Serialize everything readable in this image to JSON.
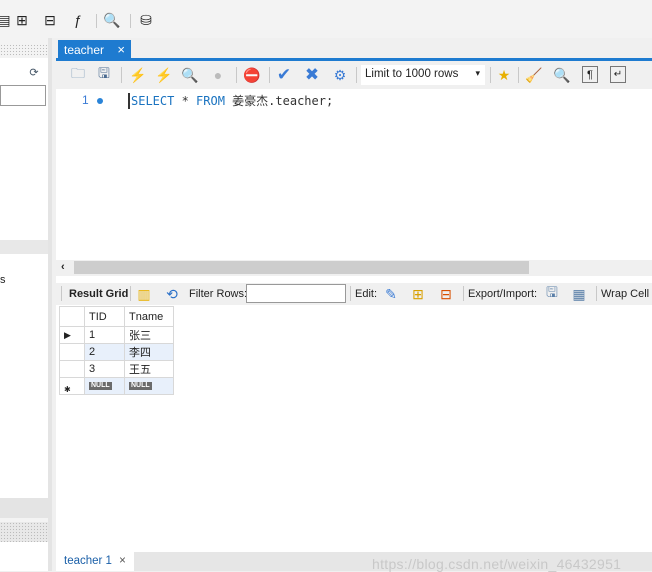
{
  "toolbar": {
    "icons": [
      "sql-file-icon",
      "new-table-icon",
      "new-view-icon",
      "new-procedure-icon",
      "new-function-icon",
      "inspector-icon",
      "reconnect-icon"
    ]
  },
  "sidebar": {
    "partial_label": "s"
  },
  "editor_tab": {
    "label": "teacher",
    "close": "×"
  },
  "editor_toolbar": {
    "limit_select": "Limit to 1000 rows",
    "dropdown": "▾"
  },
  "editor": {
    "line_number": "1",
    "sql_select": "SELECT",
    "sql_star": " * ",
    "sql_from": "FROM",
    "sql_rest": " 姜豪杰.teacher;"
  },
  "results": {
    "result_grid_label": "Result Grid",
    "filter_label": "Filter Rows:",
    "filter_value": "",
    "edit_label": "Edit:",
    "export_label": "Export/Import:",
    "wrap_label": "Wrap Cell C",
    "columns": [
      "TID",
      "Tname"
    ],
    "rows": [
      [
        "1",
        "张三"
      ],
      [
        "2",
        "李四"
      ],
      [
        "3",
        "王五"
      ]
    ],
    "new_row": [
      "NULL",
      "NULL"
    ]
  },
  "bottom_tab": {
    "label": "teacher 1",
    "close": "×"
  },
  "watermark": "https://blog.csdn.net/weixin_46432951",
  "colors": {
    "accent": "#1e7bd0",
    "keyword": "#1a73c0",
    "alt_row": "#e8f0fb"
  }
}
